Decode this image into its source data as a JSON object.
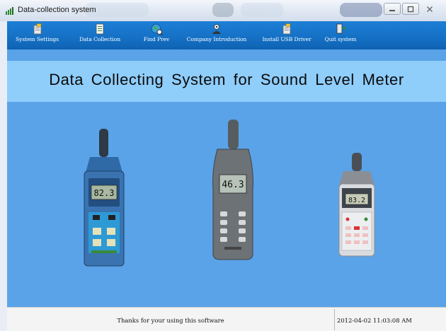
{
  "window": {
    "title": "Data-collection system",
    "controls": {
      "minimize_icon": "minimize-icon",
      "maximize_icon": "maximize-icon",
      "close_icon": "close-icon"
    }
  },
  "toolbar": {
    "items": [
      {
        "label": "System Settings",
        "icon": "settings-doc-icon"
      },
      {
        "label": "Data Collection",
        "icon": "data-sheet-icon"
      },
      {
        "label": "Find Prev",
        "icon": "find-globe-icon"
      },
      {
        "label": "Company Introduction",
        "icon": "company-icon"
      },
      {
        "label": "Install USB Driver",
        "icon": "install-doc-icon"
      },
      {
        "label": "Quit system",
        "icon": "exit-door-icon"
      }
    ]
  },
  "banner": {
    "title": "Data Collecting System for Sound Level Meter"
  },
  "meters": [
    {
      "reading": "82.3"
    },
    {
      "reading": "46.3"
    },
    {
      "reading": "83.2"
    }
  ],
  "status": {
    "message": "Thanks for your using this software",
    "datetime": "2012-04-02 11:03:08 AM"
  },
  "colors": {
    "toolbar": "#1570c4",
    "banner": "#8fcdfb",
    "main": "#5aa3e8"
  }
}
